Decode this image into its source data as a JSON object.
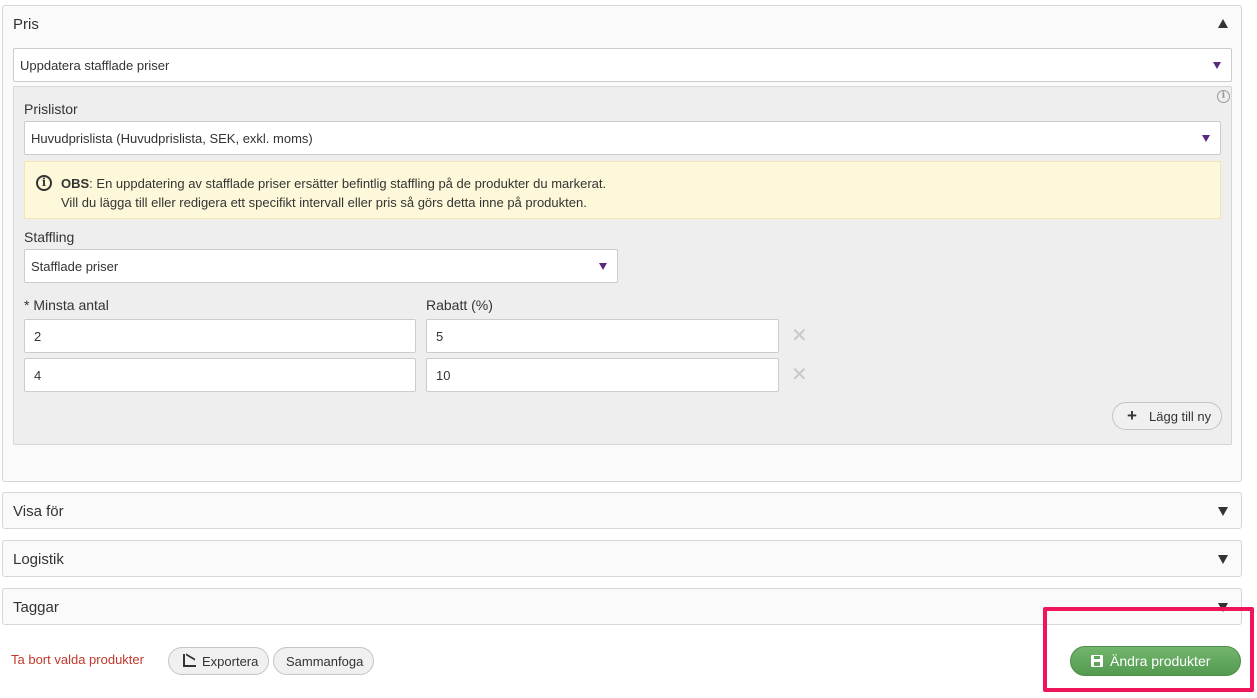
{
  "pris_section": {
    "title": "Pris",
    "update_type": "Uppdatera stafflade priser",
    "prislistor_label": "Prislistor",
    "prislista_value": "Huvudprislista (Huvudprislista, SEK, exkl. moms)",
    "notice": {
      "bold": "OBS",
      "line1": ": En uppdatering av stafflade priser ersätter befintlig staffling på de produkter du markerat.",
      "line2": "Vill du lägga till eller redigera ett specifikt intervall eller pris så görs detta inne på produkten."
    },
    "staffling_label": "Staffling",
    "staffling_value": "Stafflade priser",
    "min_qty_label": "* Minsta antal",
    "discount_label": "Rabatt (%)",
    "rows": [
      {
        "min_qty": "2",
        "discount": "5"
      },
      {
        "min_qty": "4",
        "discount": "10"
      }
    ],
    "add_new_label": "Lägg till ny"
  },
  "sections": {
    "visa_for": "Visa för",
    "logistik": "Logistik",
    "taggar": "Taggar"
  },
  "footer": {
    "delete_link": "Ta bort valda produkter",
    "export_label": "Exportera",
    "merge_label": "Sammanfoga",
    "primary_label": "Ändra produkter"
  },
  "colors": {
    "primary_green": "#5fa55a",
    "danger_red": "#c0392b",
    "highlight": "#f0145a",
    "notice_bg": "#fcf8d9",
    "caret_purple": "#5a2a82"
  }
}
